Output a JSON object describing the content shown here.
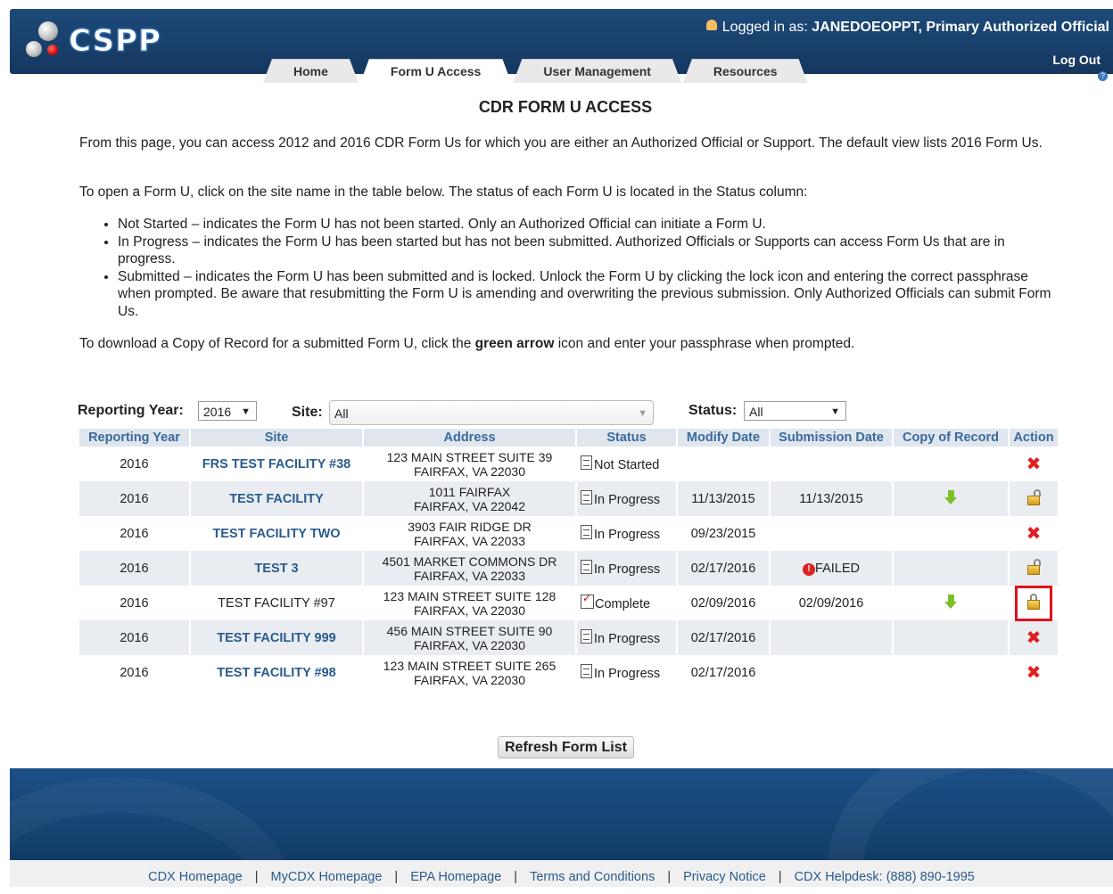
{
  "header": {
    "logo_text": "CSPP",
    "logged_in_label": "Logged in as:",
    "logged_in_user": "JANEDOEOPPT, Primary Authorized Official",
    "logout": "Log Out"
  },
  "tabs": [
    {
      "label": "Home",
      "active": false
    },
    {
      "label": "Form U Access",
      "active": true
    },
    {
      "label": "User Management",
      "active": false
    },
    {
      "label": "Resources",
      "active": false
    }
  ],
  "page": {
    "title": "CDR FORM U ACCESS",
    "intro": "From this page, you can access 2012 and 2016 CDR Form Us for which you are either an Authorized Official or Support. The default view lists 2016 Form Us.",
    "instructions": "To open a Form U, click on the site name in the table below. The status of each Form U is located in the Status column:",
    "bullets": [
      "Not Started – indicates the Form U has not been started. Only an Authorized Official can initiate a Form U.",
      "In Progress – indicates the Form U has been started but has not been submitted. Authorized Officials or Supports can access Form Us that are in progress.",
      "Submitted – indicates the Form U has been submitted and is locked. Unlock the Form U by clicking the lock icon and entering the correct passphrase when prompted. Be aware that resubmitting the Form U is amending and overwriting the previous submission. Only Authorized Officials can submit Form Us."
    ],
    "download_pre": "To download a Copy of Record for a submitted Form U, click the ",
    "download_bold": "green arrow",
    "download_post": " icon and enter your passphrase when prompted."
  },
  "filters": {
    "year_label": "Reporting Year:",
    "year_value": "2016",
    "site_label": "Site:",
    "site_value": "All",
    "status_label": "Status:",
    "status_value": "All"
  },
  "table": {
    "headers": [
      "Reporting Year",
      "Site",
      "Address",
      "Status",
      "Modify Date",
      "Submission Date",
      "Copy of Record",
      "Action"
    ],
    "rows": [
      {
        "year": "2016",
        "site": "FRS TEST FACILITY #38",
        "addr1": "123 MAIN STREET SUITE 39",
        "addr2": "FAIRFAX, VA 22030",
        "status": "Not Started",
        "modify": "",
        "submission": "",
        "copy": false,
        "action": "delete"
      },
      {
        "year": "2016",
        "site": "TEST FACILITY",
        "addr1": "1011 FAIRFAX",
        "addr2": "FAIRFAX, VA 22042",
        "status": "In Progress",
        "modify": "11/13/2015",
        "submission": "11/13/2015",
        "copy": true,
        "action": "unlocked"
      },
      {
        "year": "2016",
        "site": "TEST FACILITY TWO",
        "addr1": "3903 FAIR RIDGE DR",
        "addr2": "FAIRFAX, VA 22033",
        "status": "In Progress",
        "modify": "09/23/2015",
        "submission": "",
        "copy": false,
        "action": "delete"
      },
      {
        "year": "2016",
        "site": "TEST 3",
        "addr1": "4501 MARKET COMMONS DR",
        "addr2": "FAIRFAX, VA 22033",
        "status": "In Progress",
        "modify": "02/17/2016",
        "submission": "FAILED",
        "copy": false,
        "action": "unlocked"
      },
      {
        "year": "2016",
        "site": "TEST FACILITY #97",
        "addr1": "123 MAIN STREET SUITE 128",
        "addr2": "FAIRFAX, VA 22030",
        "status": "Complete",
        "modify": "02/09/2016",
        "submission": "02/09/2016",
        "copy": true,
        "action": "locked"
      },
      {
        "year": "2016",
        "site": "TEST FACILITY 999",
        "addr1": "456 MAIN STREET SUITE 90",
        "addr2": "FAIRFAX, VA 22030",
        "status": "In Progress",
        "modify": "02/17/2016",
        "submission": "",
        "copy": false,
        "action": "delete"
      },
      {
        "year": "2016",
        "site": "TEST FACILITY #98",
        "addr1": "123 MAIN STREET SUITE 265",
        "addr2": "FAIRFAX, VA 22030",
        "status": "In Progress",
        "modify": "02/17/2016",
        "submission": "",
        "copy": false,
        "action": "delete"
      }
    ]
  },
  "refresh_button": "Refresh Form List",
  "footer": {
    "links": [
      "CDX Homepage",
      "MyCDX Homepage",
      "EPA Homepage",
      "Terms and Conditions",
      "Privacy Notice",
      "CDX Helpdesk: (888) 890-1995"
    ]
  }
}
